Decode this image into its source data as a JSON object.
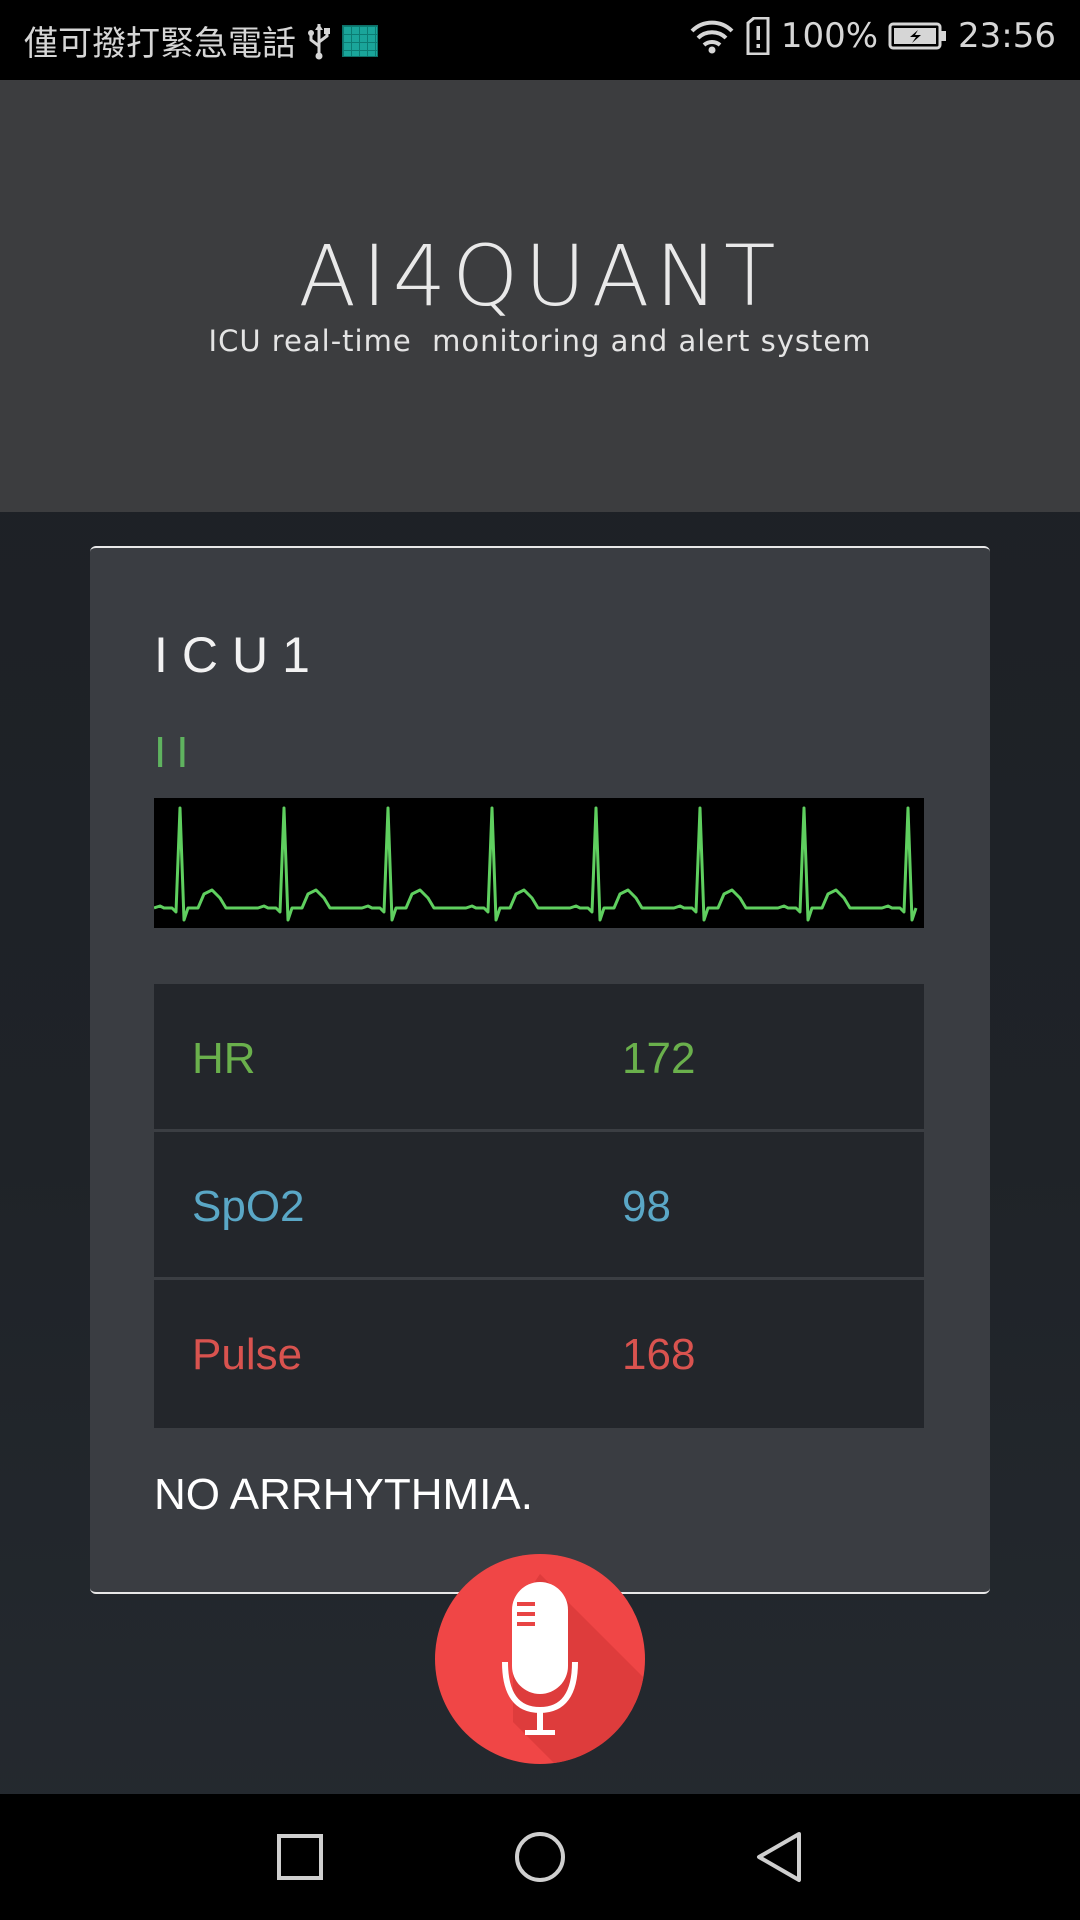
{
  "status_bar": {
    "carrier_text": "僅可撥打緊急電話",
    "battery_percent": "100%",
    "time": "23:56",
    "icons": [
      "usb-icon",
      "screenshot-thumbnail-icon",
      "wifi-icon",
      "sim-alert-icon",
      "battery-charging-icon"
    ]
  },
  "header": {
    "brand": "AI4QUANT",
    "tagline": "ICU real-time  monitoring and alert system"
  },
  "monitor": {
    "room": "ICU1",
    "lead": "II",
    "vitals": [
      {
        "label": "HR",
        "value": "172",
        "color": "#6ab04c"
      },
      {
        "label": "SpO2",
        "value": "98",
        "color": "#5aa7c6"
      },
      {
        "label": "Pulse",
        "value": "168",
        "color": "#d9534f"
      }
    ],
    "status": "NO ARRHYTHMIA."
  },
  "colors": {
    "ecg_trace": "#5fcf5f",
    "mic_button": "#f04646",
    "header_bg": "#3c3d3f",
    "card_bg": "#3a3d42"
  },
  "actions": {
    "mic_icon": "microphone-icon"
  },
  "nav": {
    "icons": [
      "recent-apps-icon",
      "home-icon",
      "back-icon"
    ]
  }
}
